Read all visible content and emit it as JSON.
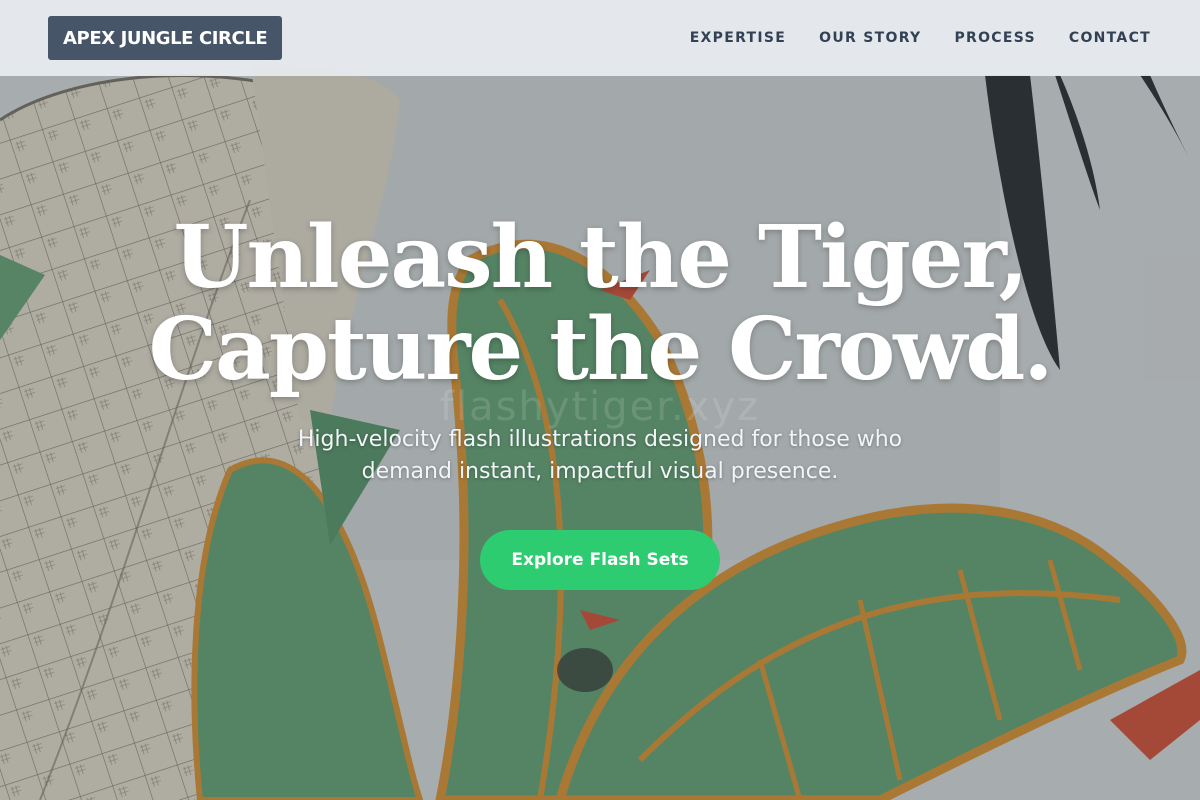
{
  "brand": {
    "name": "APEX JUNGLE CIRCLE"
  },
  "nav": {
    "items": [
      {
        "label": "EXPERTISE"
      },
      {
        "label": "OUR STORY"
      },
      {
        "label": "PROCESS"
      },
      {
        "label": "CONTACT"
      }
    ]
  },
  "hero": {
    "title_line1": "Unleash the Tiger,",
    "title_line2": "Capture the Crowd.",
    "subtitle": "High-velocity flash illustrations designed for those who demand instant, impactful visual presence.",
    "cta_label": "Explore Flash Sets",
    "watermark": "flashytiger.xyz"
  },
  "colors": {
    "brand_bg": "#475569",
    "nav_text": "#334155",
    "cta_bg": "#2ecc71",
    "header_bg": "#e8ecf0"
  }
}
